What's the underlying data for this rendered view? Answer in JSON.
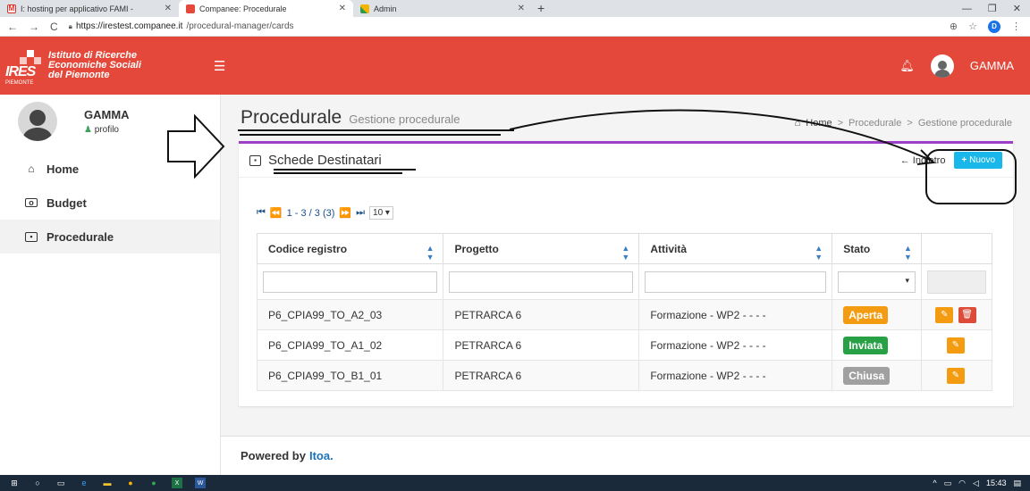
{
  "browser": {
    "tabs": [
      {
        "label": "I: hosting per applicativo FAMI - ",
        "icon": "gmail-icon",
        "color": "#d93025"
      },
      {
        "label": "Companee: Procedurale",
        "icon": "companee-icon",
        "color": "#e3483b"
      },
      {
        "label": "Admin",
        "icon": "admin-chart-icon",
        "color": "#2e9b4a"
      }
    ],
    "new_tab": "+",
    "url_host": "https://irestest.companee.it",
    "url_path": "/procedural-manager/cards",
    "profile_letter": "D"
  },
  "header": {
    "logo_line1": "Istituto di Ricerche",
    "logo_line2": "Economiche Sociali",
    "logo_line3": "del Piemonte",
    "logo_mark": "IRES",
    "logo_sub": "PIEMONTE",
    "user_name": "GAMMA",
    "accent": "#e3483b"
  },
  "sidebar": {
    "user_name": "GAMMA",
    "profile_link": "profilo",
    "items": [
      {
        "label": "Home",
        "icon": "home-icon"
      },
      {
        "label": "Budget",
        "icon": "budget-icon"
      },
      {
        "label": "Procedurale",
        "icon": "procedurale-icon"
      }
    ],
    "active": "Procedurale"
  },
  "page": {
    "title": "Procedurale",
    "subtitle": "Gestione procedurale",
    "breadcrumb": [
      "Home",
      "Procedurale",
      "Gestione procedurale"
    ]
  },
  "panel": {
    "title": "Schede Destinatari",
    "back_label": "Indietro",
    "new_label": "Nuovo",
    "border_color": "#9b3fc7"
  },
  "pager": {
    "summary": "1 - 3 / 3 (3)",
    "page_size": "10"
  },
  "table": {
    "columns": [
      "Codice registro",
      "Progetto",
      "Attività",
      "Stato"
    ],
    "rows": [
      {
        "codice": "P6_CPIA99_TO_A2_03",
        "progetto": "PETRARCA 6",
        "attivita": "Formazione - WP2 - - - -",
        "stato": "Aperta",
        "stato_color": "#f39c12",
        "delete": true
      },
      {
        "codice": "P6_CPIA99_TO_A1_02",
        "progetto": "PETRARCA 6",
        "attivita": "Formazione - WP2 - - - -",
        "stato": "Inviata",
        "stato_color": "#27a046",
        "delete": false
      },
      {
        "codice": "P6_CPIA99_TO_B1_01",
        "progetto": "PETRARCA 6",
        "attivita": "Formazione - WP2 - - - -",
        "stato": "Chiusa",
        "stato_color": "#a0a0a0",
        "delete": false
      }
    ]
  },
  "footer": {
    "text": "Powered by",
    "link": "Itoa."
  },
  "taskbar": {
    "time": "15:43"
  }
}
